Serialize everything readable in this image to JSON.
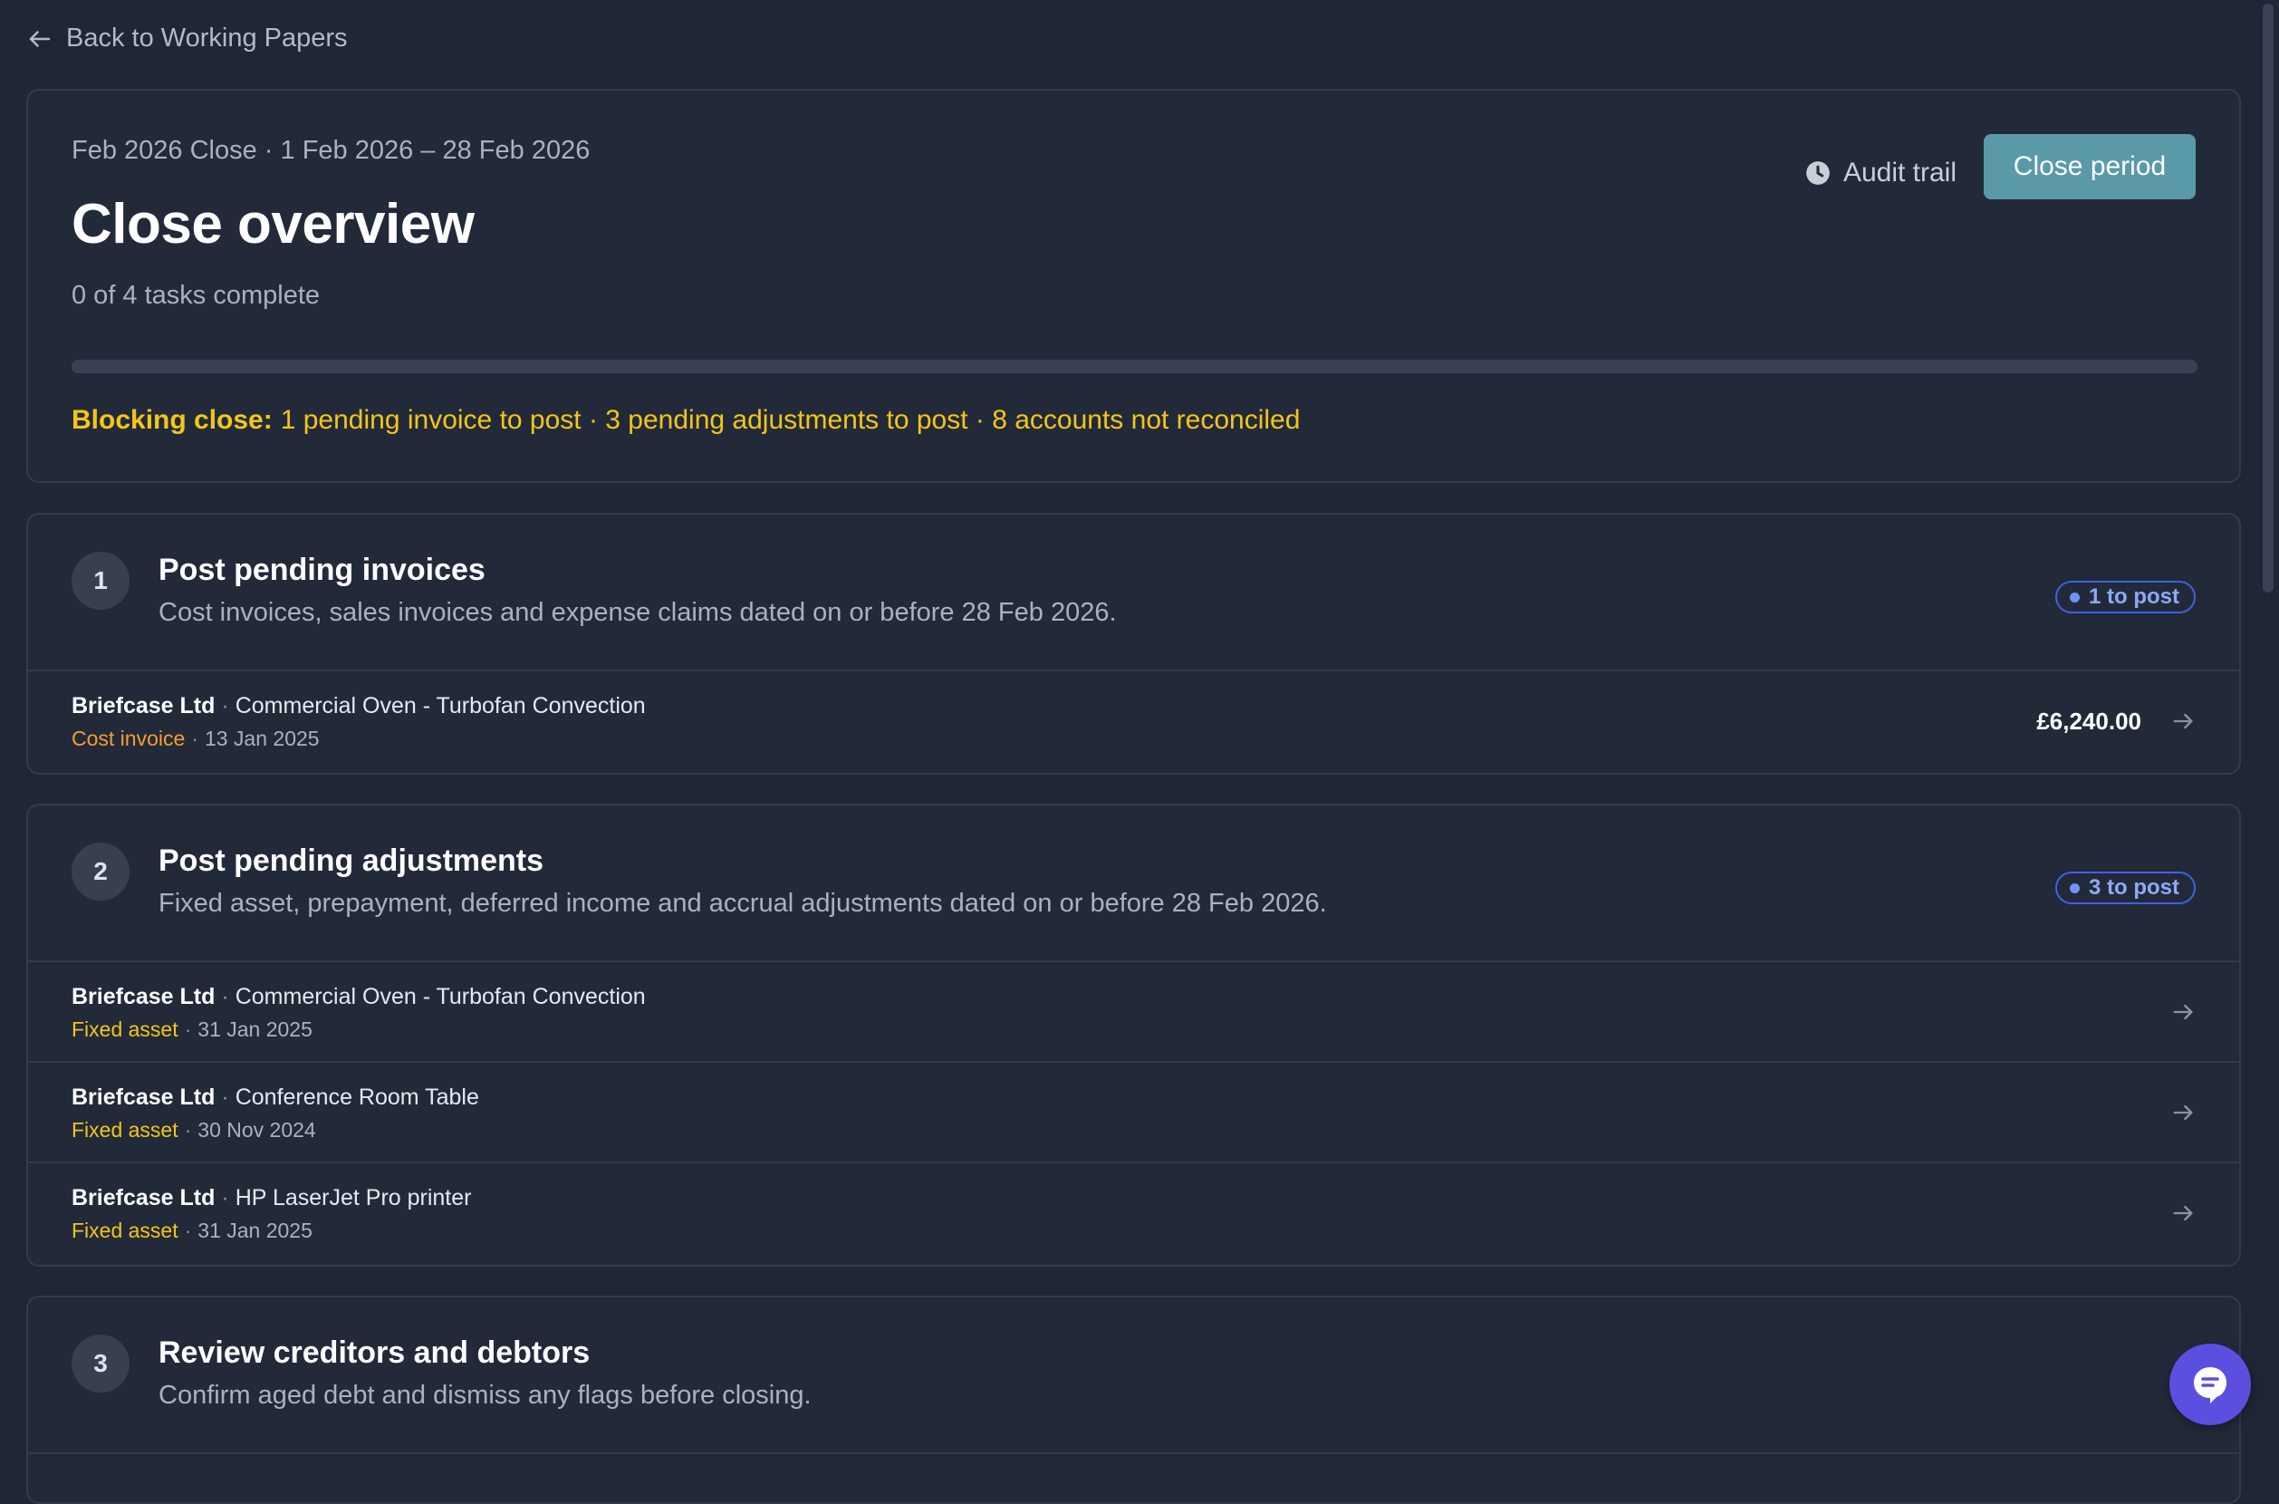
{
  "nav": {
    "back_label": "Back to Working Papers"
  },
  "overview": {
    "period": "Feb 2026 Close · 1 Feb 2026 – 28 Feb 2026",
    "title": "Close overview",
    "progress_text": "0 of 4 tasks complete",
    "progress_fraction": 0,
    "blocking_label": "Blocking close:",
    "blocking_text": "1 pending invoice to post · 3 pending adjustments to post · 8 accounts not reconciled",
    "audit_label": "Audit trail",
    "audit_icon": "clock-icon",
    "close_label": "Close period"
  },
  "tasks": [
    {
      "number": "1",
      "title": "Post pending invoices",
      "description": "Cost invoices, sales invoices and expense claims dated on or before 28 Feb 2026.",
      "badge": "1 to post",
      "rows": [
        {
          "company": "Briefcase Ltd",
          "item": "Commercial Oven - Turbofan Convection",
          "type": "Cost invoice",
          "date": "13 Jan 2025",
          "amount": "£6,240.00"
        }
      ]
    },
    {
      "number": "2",
      "title": "Post pending adjustments",
      "description": "Fixed asset, prepayment, deferred income and accrual adjustments dated on or before 28 Feb 2026.",
      "badge": "3 to post",
      "rows": [
        {
          "company": "Briefcase Ltd",
          "item": "Commercial Oven - Turbofan Convection",
          "type": "Fixed asset",
          "date": "31 Jan 2025"
        },
        {
          "company": "Briefcase Ltd",
          "item": "Conference Room Table",
          "type": "Fixed asset",
          "date": "30 Nov 2024"
        },
        {
          "company": "Briefcase Ltd",
          "item": "HP LaserJet Pro printer",
          "type": "Fixed asset",
          "date": "31 Jan 2025"
        }
      ]
    },
    {
      "number": "3",
      "title": "Review creditors and debtors",
      "description": "Confirm aged debt and dismiss any flags before closing."
    }
  ],
  "colors": {
    "background": "#1f2635",
    "accent": "#5a9aa8",
    "warning": "#f5c518",
    "cost_invoice": "#f59e2b",
    "badge": "#3d63e0",
    "chat": "#5b4fe0"
  }
}
